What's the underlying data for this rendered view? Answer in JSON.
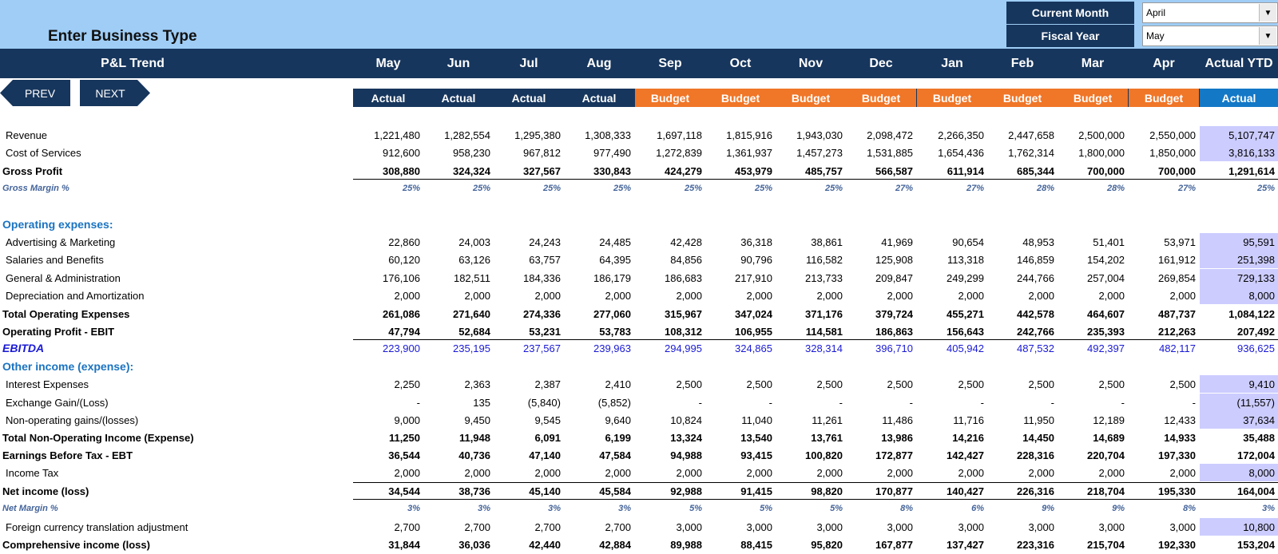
{
  "business_title": "Enter Business Type",
  "selectors": [
    {
      "label": "Current Month",
      "value": "April"
    },
    {
      "label": "Fiscal Year",
      "value": "May"
    }
  ],
  "report_title": "P&L Trend",
  "months": [
    "May",
    "Jun",
    "Jul",
    "Aug",
    "Sep",
    "Oct",
    "Nov",
    "Dec",
    "Jan",
    "Feb",
    "Mar",
    "Apr"
  ],
  "ytd_header": "Actual YTD",
  "scenario_labels": [
    "Actual",
    "Actual",
    "Actual",
    "Actual",
    "Budget",
    "Budget",
    "Budget",
    "Budget",
    "Budget",
    "Budget",
    "Budget",
    "Budget"
  ],
  "ytd_scenario": "Actual",
  "nav": {
    "prev": "PREV",
    "next": "NEXT"
  },
  "colors": {
    "navy": "#17365d",
    "budget_orange": "#f07628",
    "ytd_blue": "#1378c6",
    "top_band": "#9fcdf6",
    "ytd_cell": "#ccccff",
    "ebitda_blue": "#1a1ad4",
    "section_blue": "#1a73c0",
    "pct_blue": "#44649a"
  },
  "rows": [
    {
      "label": "Revenue",
      "style": "normal",
      "ytd_shaded": true,
      "values": [
        "1,221,480",
        "1,282,554",
        "1,295,380",
        "1,308,333",
        "1,697,118",
        "1,815,916",
        "1,943,030",
        "2,098,472",
        "2,266,350",
        "2,447,658",
        "2,500,000",
        "2,550,000",
        "5,107,747"
      ]
    },
    {
      "label": "Cost of Services",
      "style": "normal",
      "ytd_shaded": true,
      "values": [
        "912,600",
        "958,230",
        "967,812",
        "977,490",
        "1,272,839",
        "1,361,937",
        "1,457,273",
        "1,531,885",
        "1,654,436",
        "1,762,314",
        "1,800,000",
        "1,850,000",
        "3,816,133"
      ]
    },
    {
      "label": "Gross Profit",
      "style": "bold",
      "rule_bottom": true,
      "values": [
        "308,880",
        "324,324",
        "327,567",
        "330,843",
        "424,279",
        "453,979",
        "485,757",
        "566,587",
        "611,914",
        "685,344",
        "700,000",
        "700,000",
        "1,291,614"
      ]
    },
    {
      "label": "Gross Margin %",
      "style": "pct",
      "values": [
        "25%",
        "25%",
        "25%",
        "25%",
        "25%",
        "25%",
        "25%",
        "27%",
        "27%",
        "28%",
        "28%",
        "27%",
        "25%"
      ]
    },
    {
      "label": "Operating expenses:",
      "style": "section",
      "values": []
    },
    {
      "label": "Advertising & Marketing",
      "style": "normal",
      "ytd_shaded": true,
      "values": [
        "22,860",
        "24,003",
        "24,243",
        "24,485",
        "42,428",
        "36,318",
        "38,861",
        "41,969",
        "90,654",
        "48,953",
        "51,401",
        "53,971",
        "95,591"
      ]
    },
    {
      "label": "Salaries and Benefits",
      "style": "normal",
      "ytd_shaded": true,
      "values": [
        "60,120",
        "63,126",
        "63,757",
        "64,395",
        "84,856",
        "90,796",
        "116,582",
        "125,908",
        "113,318",
        "146,859",
        "154,202",
        "161,912",
        "251,398"
      ]
    },
    {
      "label": "General & Administration",
      "style": "normal",
      "ytd_shaded": true,
      "values": [
        "176,106",
        "182,511",
        "184,336",
        "186,179",
        "186,683",
        "217,910",
        "213,733",
        "209,847",
        "249,299",
        "244,766",
        "257,004",
        "269,854",
        "729,133"
      ]
    },
    {
      "label": "Depreciation and Amortization",
      "style": "normal",
      "ytd_shaded": true,
      "values": [
        "2,000",
        "2,000",
        "2,000",
        "2,000",
        "2,000",
        "2,000",
        "2,000",
        "2,000",
        "2,000",
        "2,000",
        "2,000",
        "2,000",
        "8,000"
      ]
    },
    {
      "label": "Total Operating Expenses",
      "style": "bold",
      "values": [
        "261,086",
        "271,640",
        "274,336",
        "277,060",
        "315,967",
        "347,024",
        "371,176",
        "379,724",
        "455,271",
        "442,578",
        "464,607",
        "487,737",
        "1,084,122"
      ]
    },
    {
      "label": "Operating Profit - EBIT",
      "style": "bold",
      "rule_bottom": true,
      "values": [
        "47,794",
        "52,684",
        "53,231",
        "53,783",
        "108,312",
        "106,955",
        "114,581",
        "186,863",
        "156,643",
        "242,766",
        "235,393",
        "212,263",
        "207,492"
      ]
    },
    {
      "label": "EBITDA",
      "style": "ebitda",
      "values": [
        "223,900",
        "235,195",
        "237,567",
        "239,963",
        "294,995",
        "324,865",
        "328,314",
        "396,710",
        "405,942",
        "487,532",
        "492,397",
        "482,117",
        "936,625"
      ]
    },
    {
      "label": "Other income (expense):",
      "style": "section",
      "values": []
    },
    {
      "label": "Interest Expenses",
      "style": "normal",
      "ytd_shaded": true,
      "values": [
        "2,250",
        "2,363",
        "2,387",
        "2,410",
        "2,500",
        "2,500",
        "2,500",
        "2,500",
        "2,500",
        "2,500",
        "2,500",
        "2,500",
        "9,410"
      ]
    },
    {
      "label": "Exchange Gain/(Loss)",
      "style": "normal",
      "ytd_shaded": true,
      "values": [
        "-",
        "135",
        "(5,840)",
        "(5,852)",
        "-",
        "-",
        "-",
        "-",
        "-",
        "-",
        "-",
        "-",
        "(11,557)"
      ]
    },
    {
      "label": "Non-operating gains/(losses)",
      "style": "normal",
      "ytd_shaded": true,
      "values": [
        "9,000",
        "9,450",
        "9,545",
        "9,640",
        "10,824",
        "11,040",
        "11,261",
        "11,486",
        "11,716",
        "11,950",
        "12,189",
        "12,433",
        "37,634"
      ]
    },
    {
      "label": "Total Non-Operating Income (Expense)",
      "style": "bold",
      "values": [
        "11,250",
        "11,948",
        "6,091",
        "6,199",
        "13,324",
        "13,540",
        "13,761",
        "13,986",
        "14,216",
        "14,450",
        "14,689",
        "14,933",
        "35,488"
      ]
    },
    {
      "label": "Earnings Before Tax - EBT",
      "style": "bold",
      "values": [
        "36,544",
        "40,736",
        "47,140",
        "47,584",
        "94,988",
        "93,415",
        "100,820",
        "172,877",
        "142,427",
        "228,316",
        "220,704",
        "197,330",
        "172,004"
      ]
    },
    {
      "label": "Income Tax",
      "style": "normal",
      "ytd_shaded": true,
      "values": [
        "2,000",
        "2,000",
        "2,000",
        "2,000",
        "2,000",
        "2,000",
        "2,000",
        "2,000",
        "2,000",
        "2,000",
        "2,000",
        "2,000",
        "8,000"
      ]
    },
    {
      "label": "Net income (loss)",
      "style": "bold",
      "rule_top": true,
      "rule_bottom": true,
      "values": [
        "34,544",
        "38,736",
        "45,140",
        "45,584",
        "92,988",
        "91,415",
        "98,820",
        "170,877",
        "140,427",
        "226,316",
        "218,704",
        "195,330",
        "164,004"
      ]
    },
    {
      "label": "Net Margin %",
      "style": "pct",
      "values": [
        "3%",
        "3%",
        "3%",
        "3%",
        "5%",
        "5%",
        "5%",
        "8%",
        "6%",
        "9%",
        "9%",
        "8%",
        "3%"
      ]
    },
    {
      "label": "Foreign currency translation adjustment",
      "style": "normal",
      "ytd_shaded": true,
      "values": [
        "2,700",
        "2,700",
        "2,700",
        "2,700",
        "3,000",
        "3,000",
        "3,000",
        "3,000",
        "3,000",
        "3,000",
        "3,000",
        "3,000",
        "10,800"
      ]
    },
    {
      "label": "Comprehensive income (loss)",
      "style": "bold",
      "values": [
        "31,844",
        "36,036",
        "42,440",
        "42,884",
        "89,988",
        "88,415",
        "95,820",
        "167,877",
        "137,427",
        "223,316",
        "215,704",
        "192,330",
        "153,204"
      ]
    }
  ]
}
